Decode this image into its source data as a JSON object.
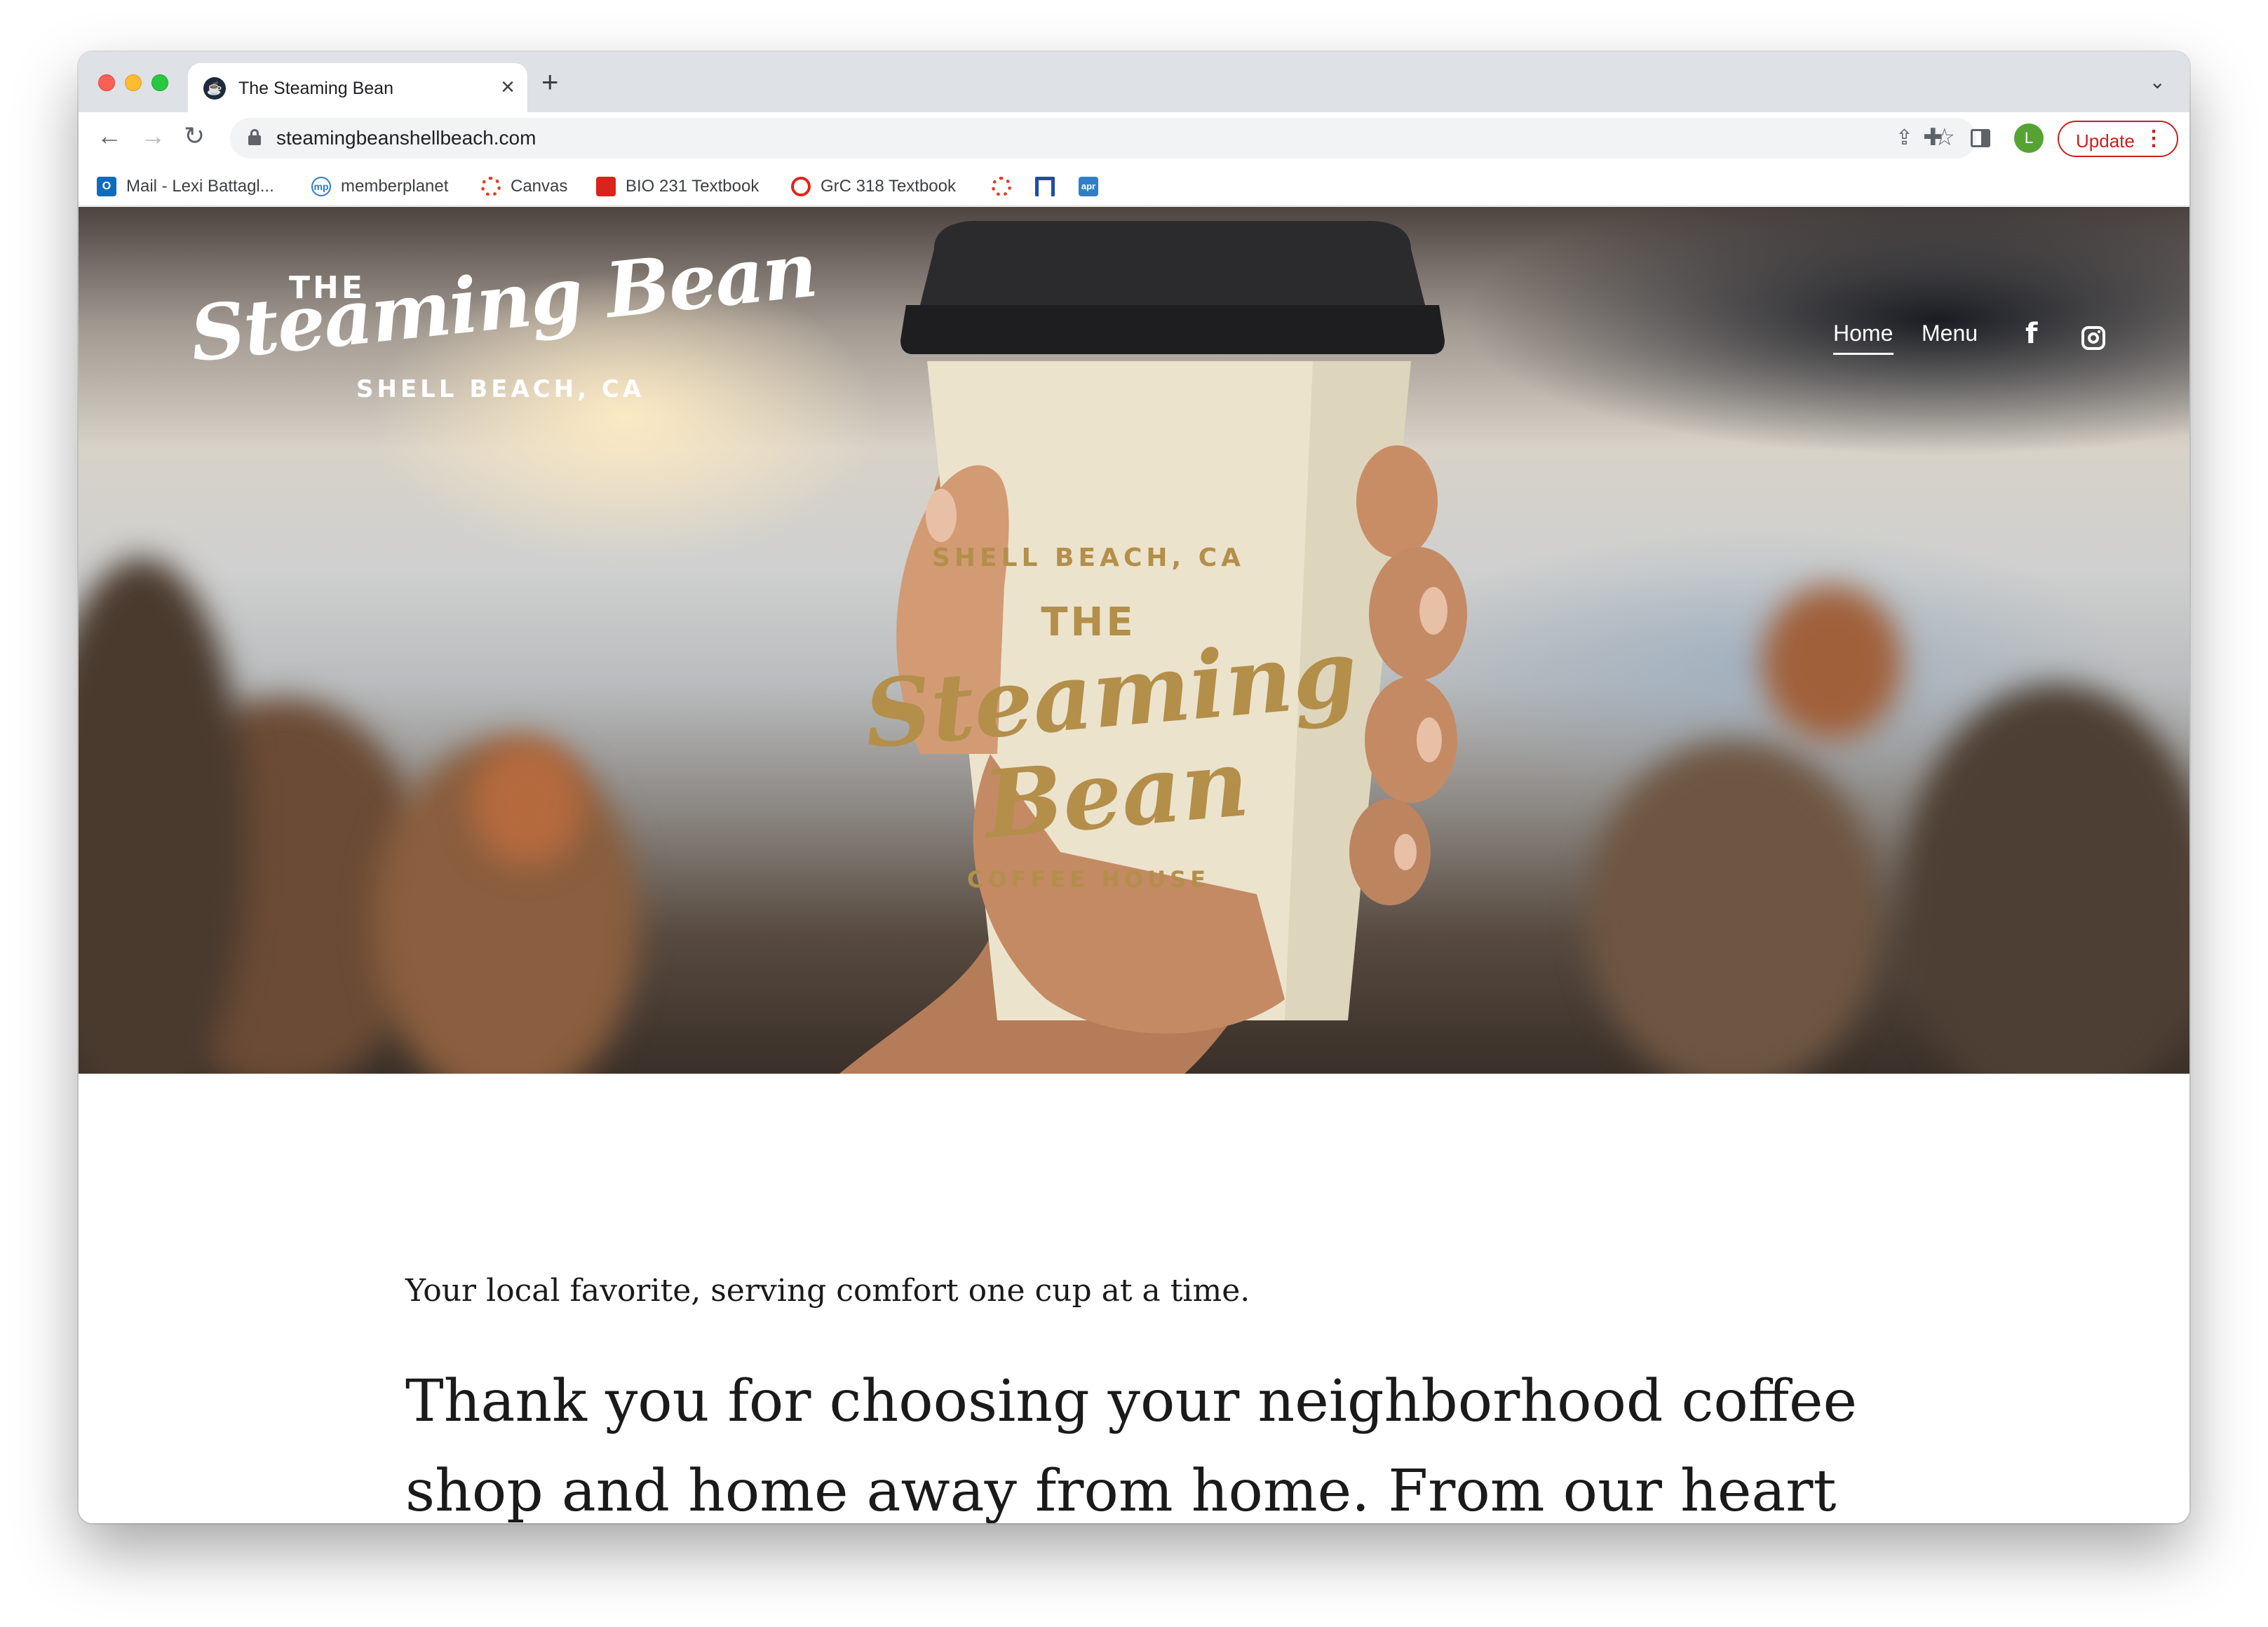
{
  "browser": {
    "tab_title": "The Steaming Bean",
    "tab_close": "×",
    "new_tab": "+",
    "url": "steamingbeanshellbeach.com",
    "avatar_letter": "L",
    "update_label": "Update",
    "icons": [
      "back-icon",
      "forward-icon",
      "reload-icon",
      "lock-icon",
      "share-icon",
      "star-icon",
      "extensions-icon",
      "side-panel-icon",
      "more-icon",
      "tab-search-icon"
    ]
  },
  "bookmarks": [
    {
      "label": "Mail - Lexi Battagl...",
      "icon": "outlook-icon"
    },
    {
      "label": "memberplanet",
      "icon": "memberplanet-icon"
    },
    {
      "label": "Canvas",
      "icon": "canvas-icon"
    },
    {
      "label": "BIO 231 Textbook",
      "icon": "textbook-icon"
    },
    {
      "label": "GrC 318 Textbook",
      "icon": "grc-icon"
    },
    {
      "label": "",
      "icon": "canvas-icon"
    },
    {
      "label": "",
      "icon": "n-icon"
    },
    {
      "label": "",
      "icon": "apr-icon"
    }
  ],
  "site": {
    "logo": {
      "the": "THE",
      "name": "Steaming Bean",
      "location": "SHELL BEACH, CA"
    },
    "nav": {
      "home": "Home",
      "menu": "Menu"
    },
    "social": [
      "facebook-icon",
      "instagram-icon"
    ],
    "cup_logo": {
      "top": "SHELL BEACH, CA",
      "the": "THE",
      "line1": "Steaming",
      "line2": "Bean",
      "bottom": "COFFEE HOUSE"
    },
    "tagline": "Your local favorite, serving comfort one cup at a time.",
    "headline": "Thank you for choosing your neighborhood coffee shop and home away from home. From our heart to"
  },
  "colors": {
    "accent_gold": "#b38f4a",
    "update_red": "#c5221f"
  }
}
